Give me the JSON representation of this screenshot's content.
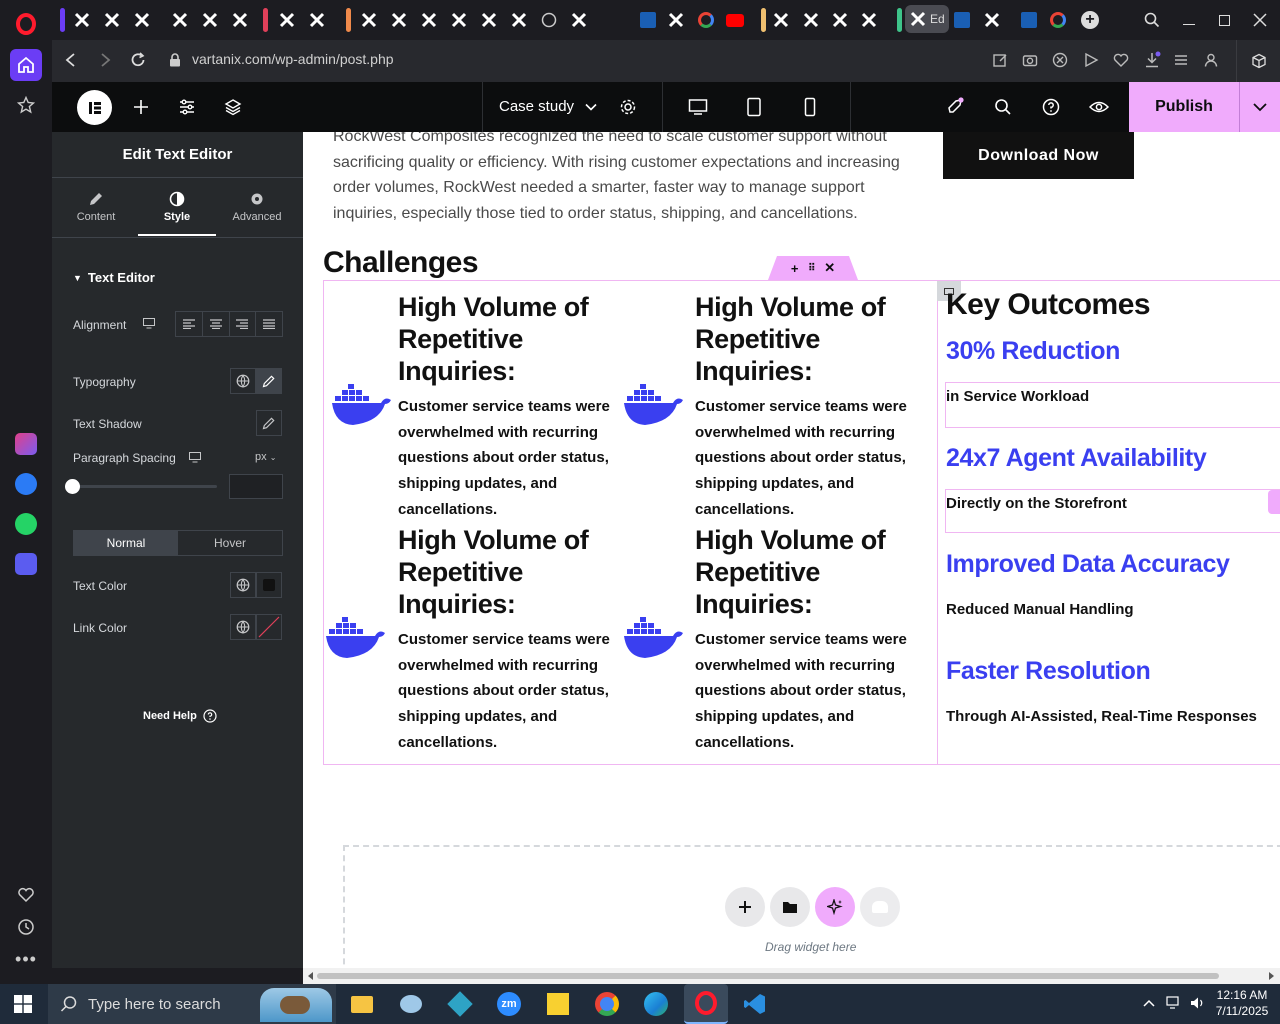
{
  "browser": {
    "url": "vartanix.com/wp-admin/post.php",
    "active_tab_label": "Ed"
  },
  "elementor": {
    "page_name": "Case study",
    "publish_label": "Publish"
  },
  "panel": {
    "title": "Edit Text Editor",
    "tabs": [
      {
        "label": "Content"
      },
      {
        "label": "Style"
      },
      {
        "label": "Advanced"
      }
    ],
    "section": "Text Editor",
    "alignment_label": "Alignment",
    "typography_label": "Typography",
    "text_shadow_label": "Text Shadow",
    "paragraph_spacing_label": "Paragraph Spacing",
    "unit": "px",
    "state_normal": "Normal",
    "state_hover": "Hover",
    "text_color_label": "Text Color",
    "link_color_label": "Link Color",
    "need_help": "Need Help"
  },
  "canvas": {
    "intro_lines": [
      "RockWest Composites recognized the need to scale customer support without",
      "sacrificing quality or efficiency. With rising customer expectations and increasing",
      "order volumes, RockWest needed a smarter, faster way to manage support",
      "inquiries, especially those tied to order status, shipping, and cancellations."
    ],
    "download_label": "Download Now",
    "challenges_heading": "Challenges",
    "cards": [
      {
        "title": "High Volume of Repetitive Inquiries:",
        "body": "Customer service teams were overwhelmed with recurring questions about order status, shipping updates, and cancellations."
      },
      {
        "title": "High Volume of Repetitive Inquiries:",
        "body": "Customer service teams were overwhelmed with recurring questions about order status, shipping updates, and cancellations."
      },
      {
        "title": "High Volume of Repetitive Inquiries:",
        "body": "Customer service teams were overwhelmed with recurring questions about order status, shipping updates, and cancellations."
      },
      {
        "title": "High Volume of Repetitive Inquiries:",
        "body": "Customer service teams were overwhelmed with recurring questions about order status, shipping updates, and cancellations."
      }
    ],
    "key_outcomes_heading": "Key Outcomes",
    "outcomes": [
      {
        "title": "30% Reduction",
        "body": "in Service Workload"
      },
      {
        "title": "24x7 Agent Availability",
        "body": "Directly on the Storefront"
      },
      {
        "title": "Improved Data Accuracy",
        "body": "Reduced Manual Handling"
      },
      {
        "title": "Faster Resolution",
        "body": "Through AI-Assisted, Real-Time Responses"
      }
    ],
    "drag_widget_label": "Drag widget here"
  },
  "taskbar": {
    "search_placeholder": "Type here to search",
    "time": "12:16 AM",
    "date": "7/11/2025"
  },
  "colors": {
    "accent_pink": "#f0abfc",
    "outcome_blue": "#3a3ff0",
    "docker_blue": "#3a3ff0"
  }
}
